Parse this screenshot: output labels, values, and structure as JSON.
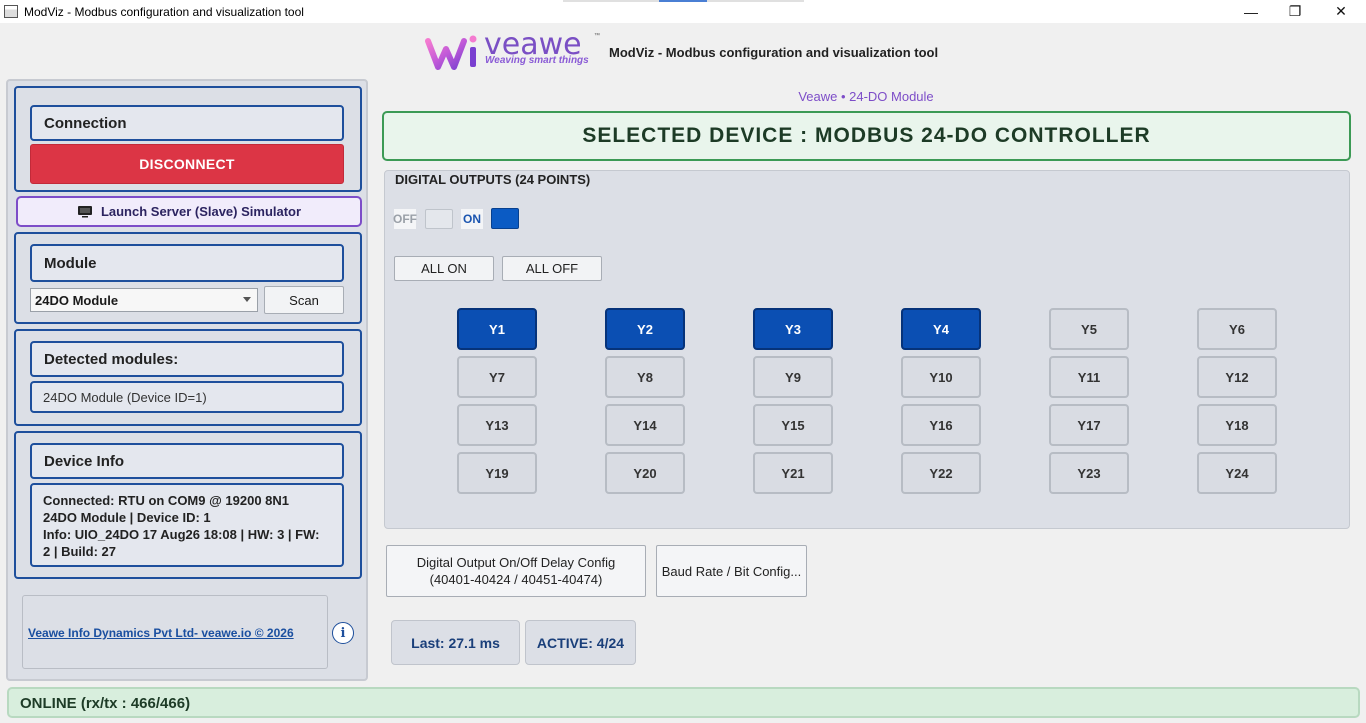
{
  "window": {
    "title": "ModViz - Modbus configuration and visualization tool",
    "controls": {
      "minimize": "—",
      "restore": "❐",
      "close": "✕"
    }
  },
  "header": {
    "logo_text": "veawe",
    "logo_tm": "™",
    "logo_tagline": "Weaving smart things",
    "app_title": "ModViz - Modbus configuration and visualization tool"
  },
  "sidebar": {
    "connection": {
      "title": "Connection",
      "disconnect_label": "DISCONNECT"
    },
    "simulator_label": "Launch Server (Slave) Simulator",
    "module": {
      "title": "Module",
      "selected": "24DO Module",
      "scan_label": "Scan"
    },
    "detected": {
      "title": "Detected modules:",
      "value": "24DO Module (Device ID=1)"
    },
    "device_info": {
      "title": "Device Info",
      "lines": [
        "Connected: RTU on COM9 @ 19200 8N1",
        "24DO Module | Device ID: 1",
        "Info: UIO_24DO   17 Aug26 18:08 | HW: 3 | FW:",
        "2 | Build: 27"
      ]
    },
    "footer_link": "Veawe Info Dynamics Pvt Ltd- veawe.io © 2026",
    "info_icon": "i"
  },
  "main": {
    "device_caption": "Veawe • 24-DO Module",
    "selected_device": "SELECTED DEVICE : MODBUS 24-DO CONTROLLER",
    "digital_outputs": {
      "title": "DIGITAL OUTPUTS (24 POINTS)",
      "legend_off": "OFF",
      "legend_on": "ON",
      "all_on_label": "ALL ON",
      "all_off_label": "ALL OFF",
      "outputs": [
        {
          "label": "Y1",
          "on": true
        },
        {
          "label": "Y2",
          "on": true
        },
        {
          "label": "Y3",
          "on": true
        },
        {
          "label": "Y4",
          "on": true
        },
        {
          "label": "Y5",
          "on": false
        },
        {
          "label": "Y6",
          "on": false
        },
        {
          "label": "Y7",
          "on": false
        },
        {
          "label": "Y8",
          "on": false
        },
        {
          "label": "Y9",
          "on": false
        },
        {
          "label": "Y10",
          "on": false
        },
        {
          "label": "Y11",
          "on": false
        },
        {
          "label": "Y12",
          "on": false
        },
        {
          "label": "Y13",
          "on": false
        },
        {
          "label": "Y14",
          "on": false
        },
        {
          "label": "Y15",
          "on": false
        },
        {
          "label": "Y16",
          "on": false
        },
        {
          "label": "Y17",
          "on": false
        },
        {
          "label": "Y18",
          "on": false
        },
        {
          "label": "Y19",
          "on": false
        },
        {
          "label": "Y20",
          "on": false
        },
        {
          "label": "Y21",
          "on": false
        },
        {
          "label": "Y22",
          "on": false
        },
        {
          "label": "Y23",
          "on": false
        },
        {
          "label": "Y24",
          "on": false
        }
      ]
    },
    "delay_config": {
      "line1": "Digital Output On/Off Delay Config",
      "line2": "(40401-40424 / 40451-40474)"
    },
    "baud_config_label": "Baud Rate / Bit Config...",
    "last_latency": "Last: 27.1 ms",
    "active_count": "ACTIVE: 4/24"
  },
  "status": {
    "text": "ONLINE (rx/tx : 466/466)"
  },
  "colors": {
    "accent": "#0b4fb3",
    "disconnect": "#dc3545",
    "brand": "#7d4dc8",
    "online": "#3c9a55"
  }
}
